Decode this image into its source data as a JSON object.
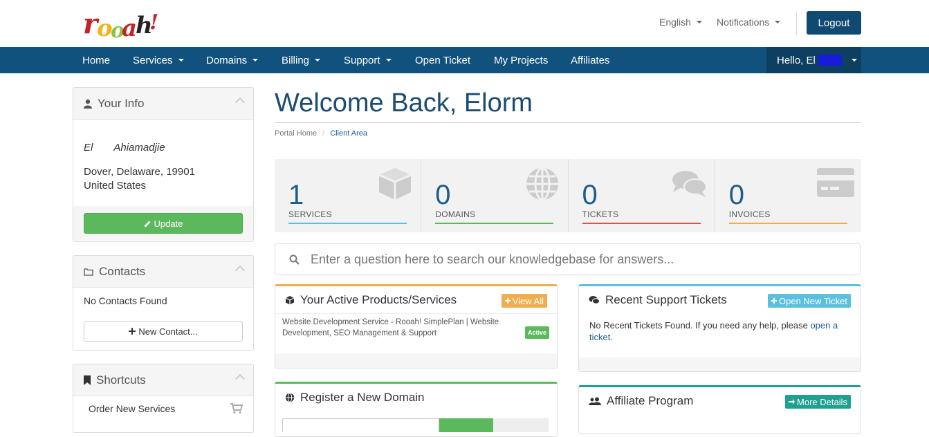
{
  "header": {
    "logo_text": "rooah!",
    "language_label": "English",
    "notifications_label": "Notifications",
    "logout_label": "Logout"
  },
  "nav": {
    "items": [
      {
        "label": "Home",
        "dropdown": false
      },
      {
        "label": "Services",
        "dropdown": true
      },
      {
        "label": "Domains",
        "dropdown": true
      },
      {
        "label": "Billing",
        "dropdown": true
      },
      {
        "label": "Support",
        "dropdown": true
      },
      {
        "label": "Open Ticket",
        "dropdown": false
      },
      {
        "label": "My Projects",
        "dropdown": false
      },
      {
        "label": "Affiliates",
        "dropdown": false
      }
    ],
    "user_greeting": "Hello, El"
  },
  "sidebar": {
    "your_info": {
      "title": "Your Info",
      "name_first": "El",
      "name_last": "Ahiamadjie",
      "address_line": "Dover, Delaware, 19901",
      "country": "United States",
      "update_label": "Update"
    },
    "contacts": {
      "title": "Contacts",
      "empty_text": "No Contacts Found",
      "new_contact_label": "New Contact..."
    },
    "shortcuts": {
      "title": "Shortcuts",
      "order_label": "Order New Services"
    }
  },
  "main": {
    "title": "Welcome Back, Elorm",
    "breadcrumb": [
      "Portal Home",
      "/",
      "Client Area"
    ],
    "stats": [
      {
        "value": "1",
        "label": "SERVICES",
        "color": "#5bc0de",
        "icon": "cube-icon"
      },
      {
        "value": "0",
        "label": "DOMAINS",
        "color": "#5cb85c",
        "icon": "globe-icon"
      },
      {
        "value": "0",
        "label": "TICKETS",
        "color": "#d9534f",
        "icon": "comments-icon"
      },
      {
        "value": "0",
        "label": "INVOICES",
        "color": "#f0ad4e",
        "icon": "credit-card-icon"
      }
    ],
    "search_placeholder": "Enter a question here to search our knowledgebase for answers...",
    "products": {
      "title": "Your Active Products/Services",
      "view_all_label": "View All",
      "item_text": "Website Development Service - Rooah! SimplePlan | Website Development, SEO Management & Support",
      "status": "Active"
    },
    "tickets": {
      "title": "Recent Support Tickets",
      "open_ticket_label": "Open New Ticket",
      "empty_text": "No Recent Tickets Found. If you need any help, please",
      "link_text": "open a ticket",
      "suffix": "."
    },
    "domain": {
      "title": "Register a New Domain"
    },
    "affiliate": {
      "title": "Affiliate Program",
      "details_label": "More Details"
    }
  }
}
